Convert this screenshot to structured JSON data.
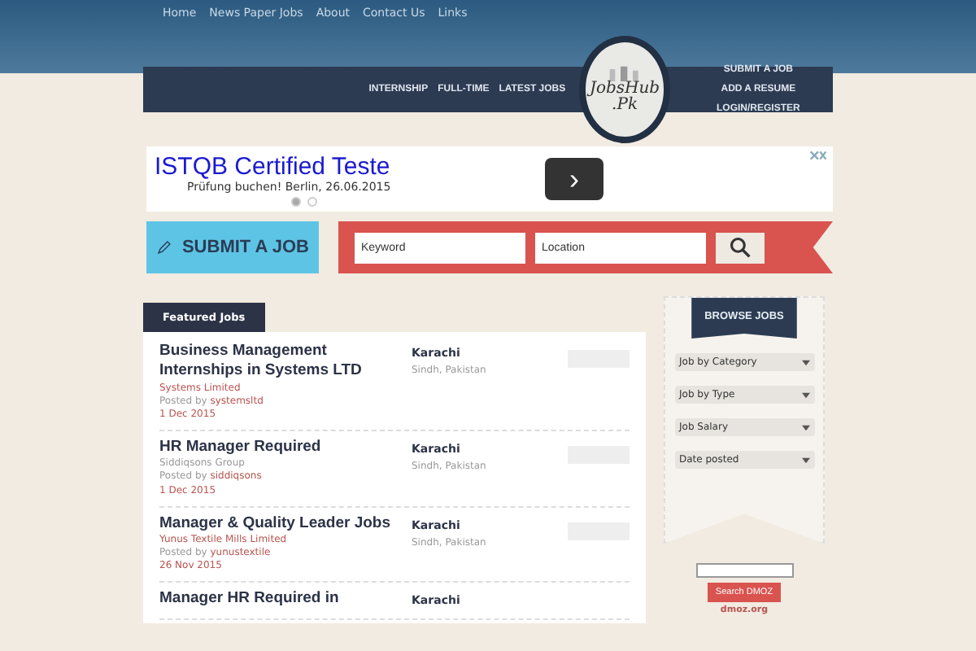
{
  "top_nav": [
    "Home",
    "News Paper Jobs",
    "About",
    "Contact Us",
    "Links"
  ],
  "ribbon_left": [
    "INTERNSHIP",
    "FULL-TIME",
    "LATEST JOBS"
  ],
  "logo": {
    "line1": "JobsHub",
    "line2": ".Pk"
  },
  "ribbon_right": [
    "SUBMIT A JOB",
    "ADD A RESUME",
    "LOGIN/REGISTER"
  ],
  "ad": {
    "headline": "ISTQB Certified Teste",
    "subline": "Prüfung buchen! Berlin, 26.06.2015",
    "next": "›",
    "dots": [
      {
        "selected": true
      },
      {
        "selected": false
      }
    ]
  },
  "submit_job": "SUBMIT A JOB",
  "search": {
    "keyword_placeholder": "Keyword",
    "location_placeholder": "Location"
  },
  "featured_tab": "Featured Jobs",
  "jobs": [
    {
      "title": "Business Management Internships in Systems LTD",
      "company": "Systems Limited",
      "company_link": true,
      "posted_by": "Posted by",
      "user": "systemsltd",
      "date": "1 Dec 2015",
      "city": "Karachi",
      "region": "Sindh, Pakistan"
    },
    {
      "title": "HR Manager Required",
      "company": "Siddiqsons Group",
      "company_link": false,
      "posted_by": "Posted by",
      "user": "siddiqsons",
      "date": "1 Dec 2015",
      "city": "Karachi",
      "region": "Sindh, Pakistan"
    },
    {
      "title": "Manager & Quality Leader Jobs",
      "company": "Yunus Textile Mills Limited",
      "company_link": true,
      "posted_by": "Posted by",
      "user": "yunustextile",
      "date": "26 Nov 2015",
      "city": "Karachi",
      "region": "Sindh, Pakistan"
    },
    {
      "title": "Manager HR Required in",
      "city": "Karachi"
    }
  ],
  "browse": {
    "title": "BROWSE JOBS",
    "selects": [
      "Job by Category",
      "Job by Type",
      "Job Salary",
      "Date posted"
    ]
  },
  "dmoz": {
    "button": "Search DMOZ",
    "link": "dmoz.org"
  }
}
